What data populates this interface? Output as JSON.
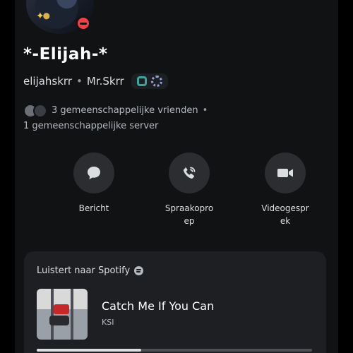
{
  "profile": {
    "display_name": "*-Elijah-*",
    "username": "elijahskrr",
    "separator": "•",
    "pronouns": "Mr.Skrr",
    "status": "do-not-disturb",
    "status_color": "#f23f43"
  },
  "mutual": {
    "friends": "3 gemeenschappelijke vrienden",
    "separator": "•",
    "servers": "1 gemeenschappelijke server"
  },
  "actions": [
    {
      "label": "Bericht",
      "icon": "chat-bubble-icon"
    },
    {
      "label": "Spraakoproep",
      "icon": "phone-call-icon"
    },
    {
      "label": "Videogesprek",
      "icon": "video-camera-icon"
    }
  ],
  "spotify": {
    "heading": "Luistert naar Spotify",
    "track_title": "Catch Me If You Can",
    "artist": "KSI",
    "progress_fraction": 0.38
  },
  "colors": {
    "background": "#111214",
    "card": "#1e1f22",
    "button": "#2b2d31"
  }
}
